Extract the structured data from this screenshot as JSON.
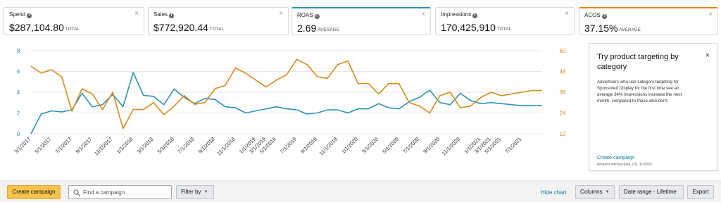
{
  "metrics": [
    {
      "label": "Spend",
      "value": "$287,104.80",
      "unit": "TOTAL"
    },
    {
      "label": "Sales",
      "value": "$772,920.44",
      "unit": "TOTAL"
    },
    {
      "label": "ROAS",
      "value": "2.69",
      "unit": "AVERAGE",
      "selected_color": "#2e92b8"
    },
    {
      "label": "Impressions",
      "value": "170,425,910",
      "unit": "TOTAL"
    },
    {
      "label": "ACOS",
      "value": "37.15%",
      "unit": "AVERAGE",
      "selected_color": "#d98a1c"
    }
  ],
  "close_glyph": "×",
  "info_glyph": "i",
  "chart_data": {
    "type": "line",
    "x": [
      "3/1/2017",
      "4/1/2017",
      "5/1/2017",
      "6/1/2017",
      "7/1/2017",
      "8/1/2017",
      "9/1/2017",
      "10/1/2017",
      "11/1/2017",
      "12/1/2017",
      "1/1/2018",
      "2/1/2018",
      "3/1/2018",
      "4/1/2018",
      "5/1/2018",
      "6/1/2018",
      "7/1/2018",
      "8/1/2018",
      "9/1/2018",
      "10/1/2018",
      "11/1/2018",
      "12/1/2018",
      "1/1/2019",
      "3/1/2019",
      "5/1/2019",
      "6/1/2019",
      "7/1/2019",
      "8/1/2019",
      "9/1/2019",
      "10/1/2019",
      "11/1/2019",
      "12/1/2019",
      "1/1/2020",
      "2/1/2020",
      "3/1/2020",
      "4/1/2020",
      "5/1/2020",
      "6/1/2020",
      "7/1/2020",
      "8/1/2020",
      "9/1/2020",
      "10/1/2020",
      "11/1/2020",
      "12/1/2020",
      "1/1/2021",
      "3/1/2021",
      "5/1/2021",
      "6/1/2021",
      "7/1/2021",
      "8/1/2021",
      "9/1/2021"
    ],
    "xticks": [
      "3/1/2017",
      "5/1/2017",
      "7/1/2017",
      "9/1/2017",
      "11/1/2017",
      "1/1/2018",
      "3/1/2018",
      "5/1/2018",
      "7/1/2018",
      "9/1/2018",
      "11/1/2018",
      "1/1/2019",
      "3/1/2019",
      "5/1/2019",
      "7/1/2019",
      "9/1/2019",
      "11/1/2019",
      "1/1/2020",
      "3/1/2020",
      "5/1/2020",
      "7/1/2020",
      "9/1/2020",
      "11/1/2020",
      "1/1/2021",
      "3/1/2021",
      "5/1/2021",
      "7/1/2021"
    ],
    "series": [
      {
        "name": "ROAS",
        "axis": "left",
        "color": "#2e92b8",
        "values": [
          0.0,
          1.9,
          2.2,
          2.1,
          2.3,
          3.9,
          2.6,
          2.8,
          3.8,
          2.6,
          5.9,
          3.7,
          3.6,
          2.8,
          4.3,
          3.5,
          2.9,
          3.4,
          3.3,
          2.6,
          2.5,
          2.0,
          2.2,
          2.4,
          2.6,
          2.4,
          2.3,
          1.9,
          2.0,
          2.3,
          2.3,
          2.0,
          2.4,
          2.4,
          2.9,
          2.5,
          2.4,
          3.1,
          3.5,
          4.2,
          3.0,
          2.8,
          3.9,
          3.2,
          2.9,
          3.0,
          2.9,
          2.8,
          2.7,
          2.7,
          2.7
        ]
      },
      {
        "name": "ACOS",
        "axis": "right",
        "color": "#d98a1c",
        "values": [
          51,
          47,
          49,
          45,
          25,
          38,
          35,
          26,
          36,
          15,
          26,
          26,
          30,
          23,
          28,
          34,
          29,
          30,
          38,
          40,
          50,
          47,
          43,
          39,
          43,
          46,
          55,
          52,
          45,
          44,
          52,
          54,
          41,
          41,
          35,
          41,
          41,
          30,
          28,
          24,
          34,
          36,
          27,
          28,
          33,
          36,
          34,
          35,
          36,
          37,
          37
        ]
      }
    ],
    "left_axis": {
      "min": 0,
      "max": 8,
      "ticks": [
        0,
        2,
        4,
        6,
        8
      ]
    },
    "right_axis": {
      "min": 12,
      "max": 60,
      "ticks": [
        12,
        24,
        36,
        48,
        60
      ]
    },
    "grid": "horizontal"
  },
  "promo": {
    "title": "Try product targeting by category",
    "body": "Advertisers who use category targeting for Sponsored Display for the first time see an average 34% impressions increase the next month, compared to those who don't.",
    "link": "Create campaign",
    "footnote": "Amazon internal data, US, 11/2020"
  },
  "toolbar": {
    "create_label": "Create campaign",
    "search_placeholder": "Find a campaign",
    "filter_label": "Filter by",
    "hide_chart_label": "Hide chart",
    "columns_label": "Columns",
    "date_range_label": "Date range - Lifetime",
    "export_label": "Export"
  },
  "icons": {
    "search": "search-icon",
    "chevron": "chevron-down-icon",
    "close": "close-icon",
    "info": "info-icon"
  },
  "colors": {
    "accent_blue": "#2e92b8",
    "accent_orange": "#d98a1c",
    "primary_button": "#f8c34c",
    "link": "#0b7b9c"
  }
}
